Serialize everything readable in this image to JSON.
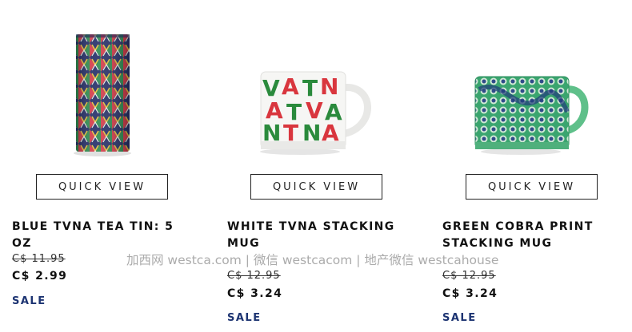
{
  "products": [
    {
      "name": "BLUE TVNA TEA TIN: 5 OZ",
      "quick_view": "QUICK VIEW",
      "original_price": "C$ 11.95",
      "price": "C$ 2.99",
      "badge": "SALE",
      "image": "tea-tin-image"
    },
    {
      "name": "WHITE TVNA STACKING MUG",
      "quick_view": "QUICK VIEW",
      "original_price": "C$ 12.95",
      "price": "C$ 3.24",
      "badge": "SALE",
      "image": "white-mug-image"
    },
    {
      "name": "GREEN COBRA PRINT STACKING MUG",
      "quick_view": "QUICK VIEW",
      "original_price": "C$ 12.95",
      "price": "C$ 3.24",
      "badge": "SALE",
      "image": "green-mug-image"
    }
  ],
  "watermark": "加西网 westca.com | 微信 westcacom | 地产微信 westcahouse",
  "colors": {
    "sale": "#1d3472",
    "border": "#222222"
  }
}
